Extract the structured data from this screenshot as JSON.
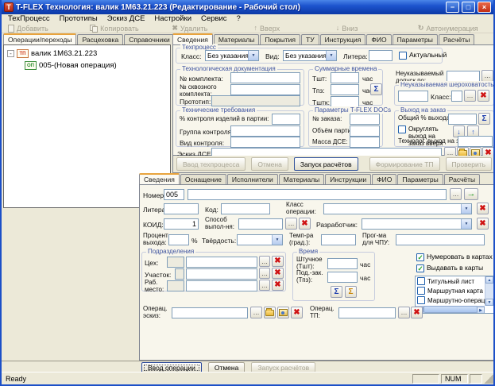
{
  "window": {
    "title": "T-FLEX Технология: валик 1М63.21.223 (Редактирование - Рабочий стол)",
    "app_icon_letter": "T"
  },
  "icons": {
    "browse": "…",
    "delete": "✖",
    "sum": "Σ",
    "dropdown": "▼",
    "check": "✓",
    "arrow_up": "↑",
    "arrow_down": "↓",
    "arrow_right": "→",
    "expander": "-",
    "minimize": "−",
    "maximize": "□",
    "close": "×",
    "scroll_up": "▲",
    "scroll_down": "▼",
    "scroll_left": "◀",
    "scroll_right": "▶",
    "autonumber": "↻",
    "plus": "+",
    "delete_x": "✖"
  },
  "menu": [
    "ТехПроцесс",
    "Прототипы",
    "Эскиз ДСЕ",
    "Настройки",
    "Сервис",
    "?"
  ],
  "toolbar": [
    "Добавить",
    "Копировать",
    "Удалить",
    "Вверх",
    "Вниз",
    "Автонумерация"
  ],
  "tree_panel": {
    "tabs": [
      "Операции/переходы",
      "Расцеховка",
      "Справочники",
      "Расчёты"
    ],
    "root_icon_text": "ТП",
    "root_label": "валик 1М63.21.223",
    "child_icon_text": "ОП",
    "child_label": "005-(Новая операция)"
  },
  "process": {
    "tabs": [
      "Сведения",
      "Материалы",
      "Покрытия",
      "ТУ",
      "Инструкция",
      "ФИО",
      "Параметры",
      "Расчёты"
    ],
    "tp_group": {
      "title": "Техпроцесс",
      "class_label": "Класс:",
      "class_value": "Без указания",
      "kind_label": "Вид:",
      "kind_value": "Без указания",
      "litera_label": "Литера:",
      "litera_value": "",
      "actual_label": "Актуальный"
    },
    "doc_group": {
      "title": "Технологическая документация",
      "set_no": "№ комплекта:",
      "through_set_no": "№ сквозного комплекта:",
      "prototype": "Прототип:"
    },
    "time_group": {
      "title": "Суммарные времена",
      "tsht": "Тшт:",
      "tpz": "Тпз:",
      "tshtk": "Тштк:",
      "hour": "час"
    },
    "tolerance_label": "Неуказываемый допуск по:",
    "rough_group": {
      "title": "Неуказываемая шероховатость",
      "class_label": "Класс:"
    },
    "req_group": {
      "title": "Технические требования",
      "control_pct": "% контроля изделий в партии:",
      "control_group": "Группа контроля:",
      "control_kind": "Вид контроля:"
    },
    "docs_group": {
      "title": "Параметры T-FLEX DOCs",
      "order_no": "№ заказа:",
      "batch": "Объём партии:",
      "mass": "Масса ДСЕ:"
    },
    "order_group": {
      "title": "Выход на заказ",
      "total_pct": "Общий % выхода:",
      "round_up": "Округлять выход на заказ вверх до целого",
      "tech_out": "Технолог. выход на заказ:"
    },
    "sketch_label": "Эскиз ДСЕ:",
    "buttons": [
      "Ввод техпроцесса",
      "Отмена",
      "Запуск расчётов",
      "Формирование ТП",
      "Проверить"
    ]
  },
  "operation": {
    "tabs": [
      "Сведения",
      "Оснащение",
      "Исполнители",
      "Материалы",
      "Инструкции",
      "ФИО",
      "Параметры",
      "Расчёты"
    ],
    "number_label": "Номер:",
    "number_value": "005",
    "litera_label": "Литера:",
    "code_label": "Код:",
    "op_class_label": "Класс операции:",
    "koid_label": "КОИД:",
    "koid_value": "1",
    "method_label": "Способ выпол-ня:",
    "developer_label": "Разработчик:",
    "out_pct_label": "Процент выхода:",
    "pct_sign": "%",
    "hardness_label": "Твёрдость:",
    "temp_label": "Темп-ра (град.):",
    "cnc_label": "Прог-ма для ЧПУ:",
    "dept_group": {
      "title": "Подразделения",
      "shop": "Цех:",
      "section": "Участок:",
      "workplace": "Раб. место:"
    },
    "time_group": {
      "title": "Время",
      "piece": "Штучное (Тшт):",
      "setup": "Под.-зак. (Тпз):",
      "hour": "час"
    },
    "checks": {
      "number_in_cards": "Нумеровать в картах",
      "output_to_cards": "Выдавать в карты"
    },
    "cards": [
      "Титульный лист",
      "Маршрутная карта",
      "Маршрутно-операционная"
    ],
    "op_sketch_label": "Операц. эскиз:",
    "op_tp_label": "Операц. ТП:",
    "buttons": [
      "Ввод операции",
      "Отмена",
      "Запуск расчётов"
    ]
  },
  "status": {
    "left": "Ready",
    "right": "NUM"
  }
}
